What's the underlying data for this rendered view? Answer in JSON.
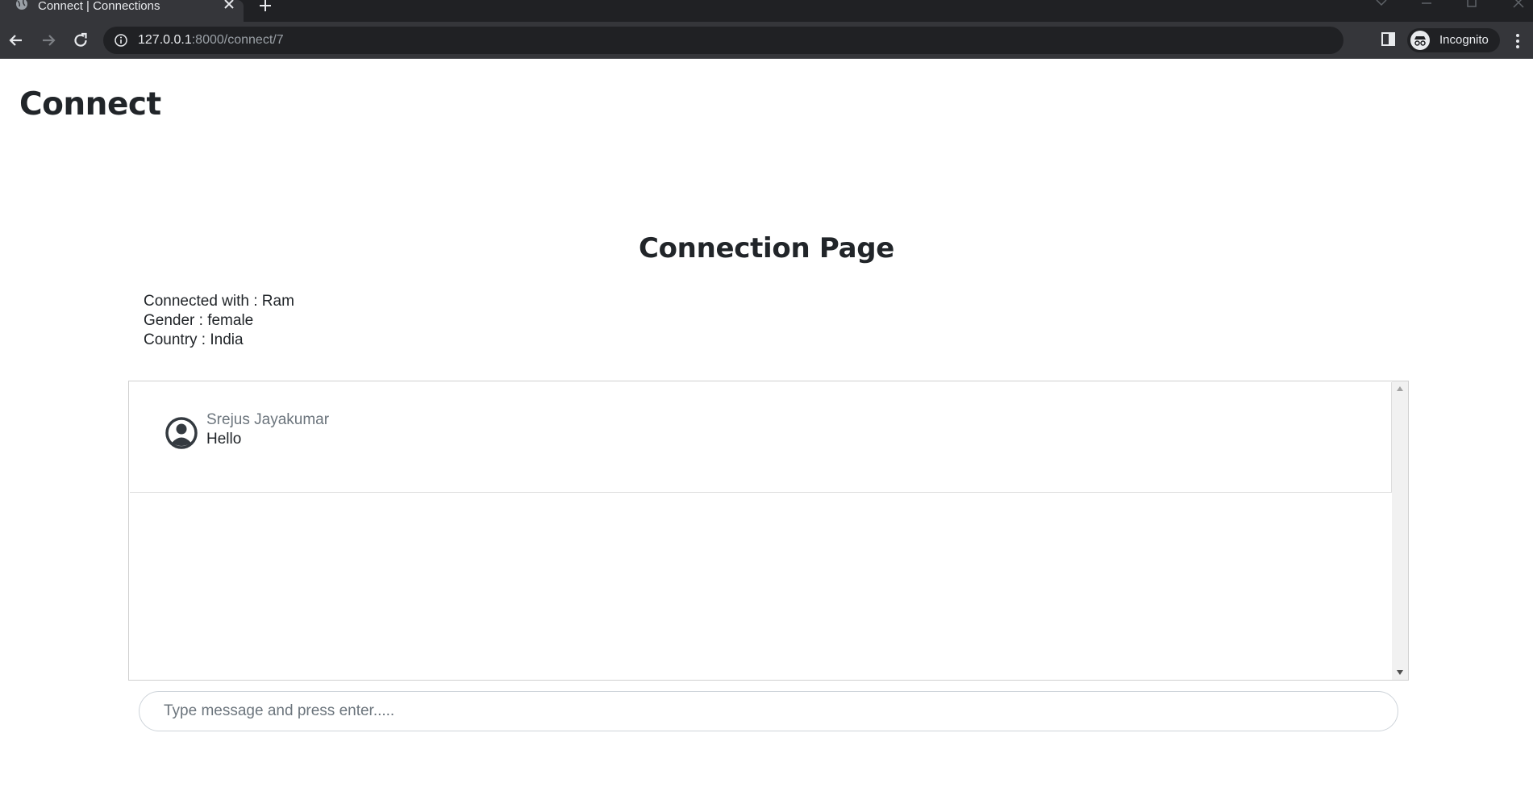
{
  "browser": {
    "tab_title": "Connect | Connections",
    "url_host": "127.0.0.1",
    "url_rest": ":8000/connect/7",
    "profile_label": "Incognito"
  },
  "header": {
    "brand": "Connect"
  },
  "main": {
    "title": "Connection Page",
    "info": {
      "connected_with": "Connected with : Ram",
      "gender": "Gender : female",
      "country": "Country : India"
    },
    "messages": [
      {
        "author": "Srejus Jayakumar",
        "text": "Hello",
        "icon": "user-circle-icon"
      }
    ],
    "input": {
      "placeholder": "Type message and press enter.....",
      "value": ""
    }
  },
  "colors": {
    "chrome_dark": "#202124",
    "chrome_toolbar": "#35363a",
    "text": "#212529",
    "muted": "#6c757d"
  }
}
